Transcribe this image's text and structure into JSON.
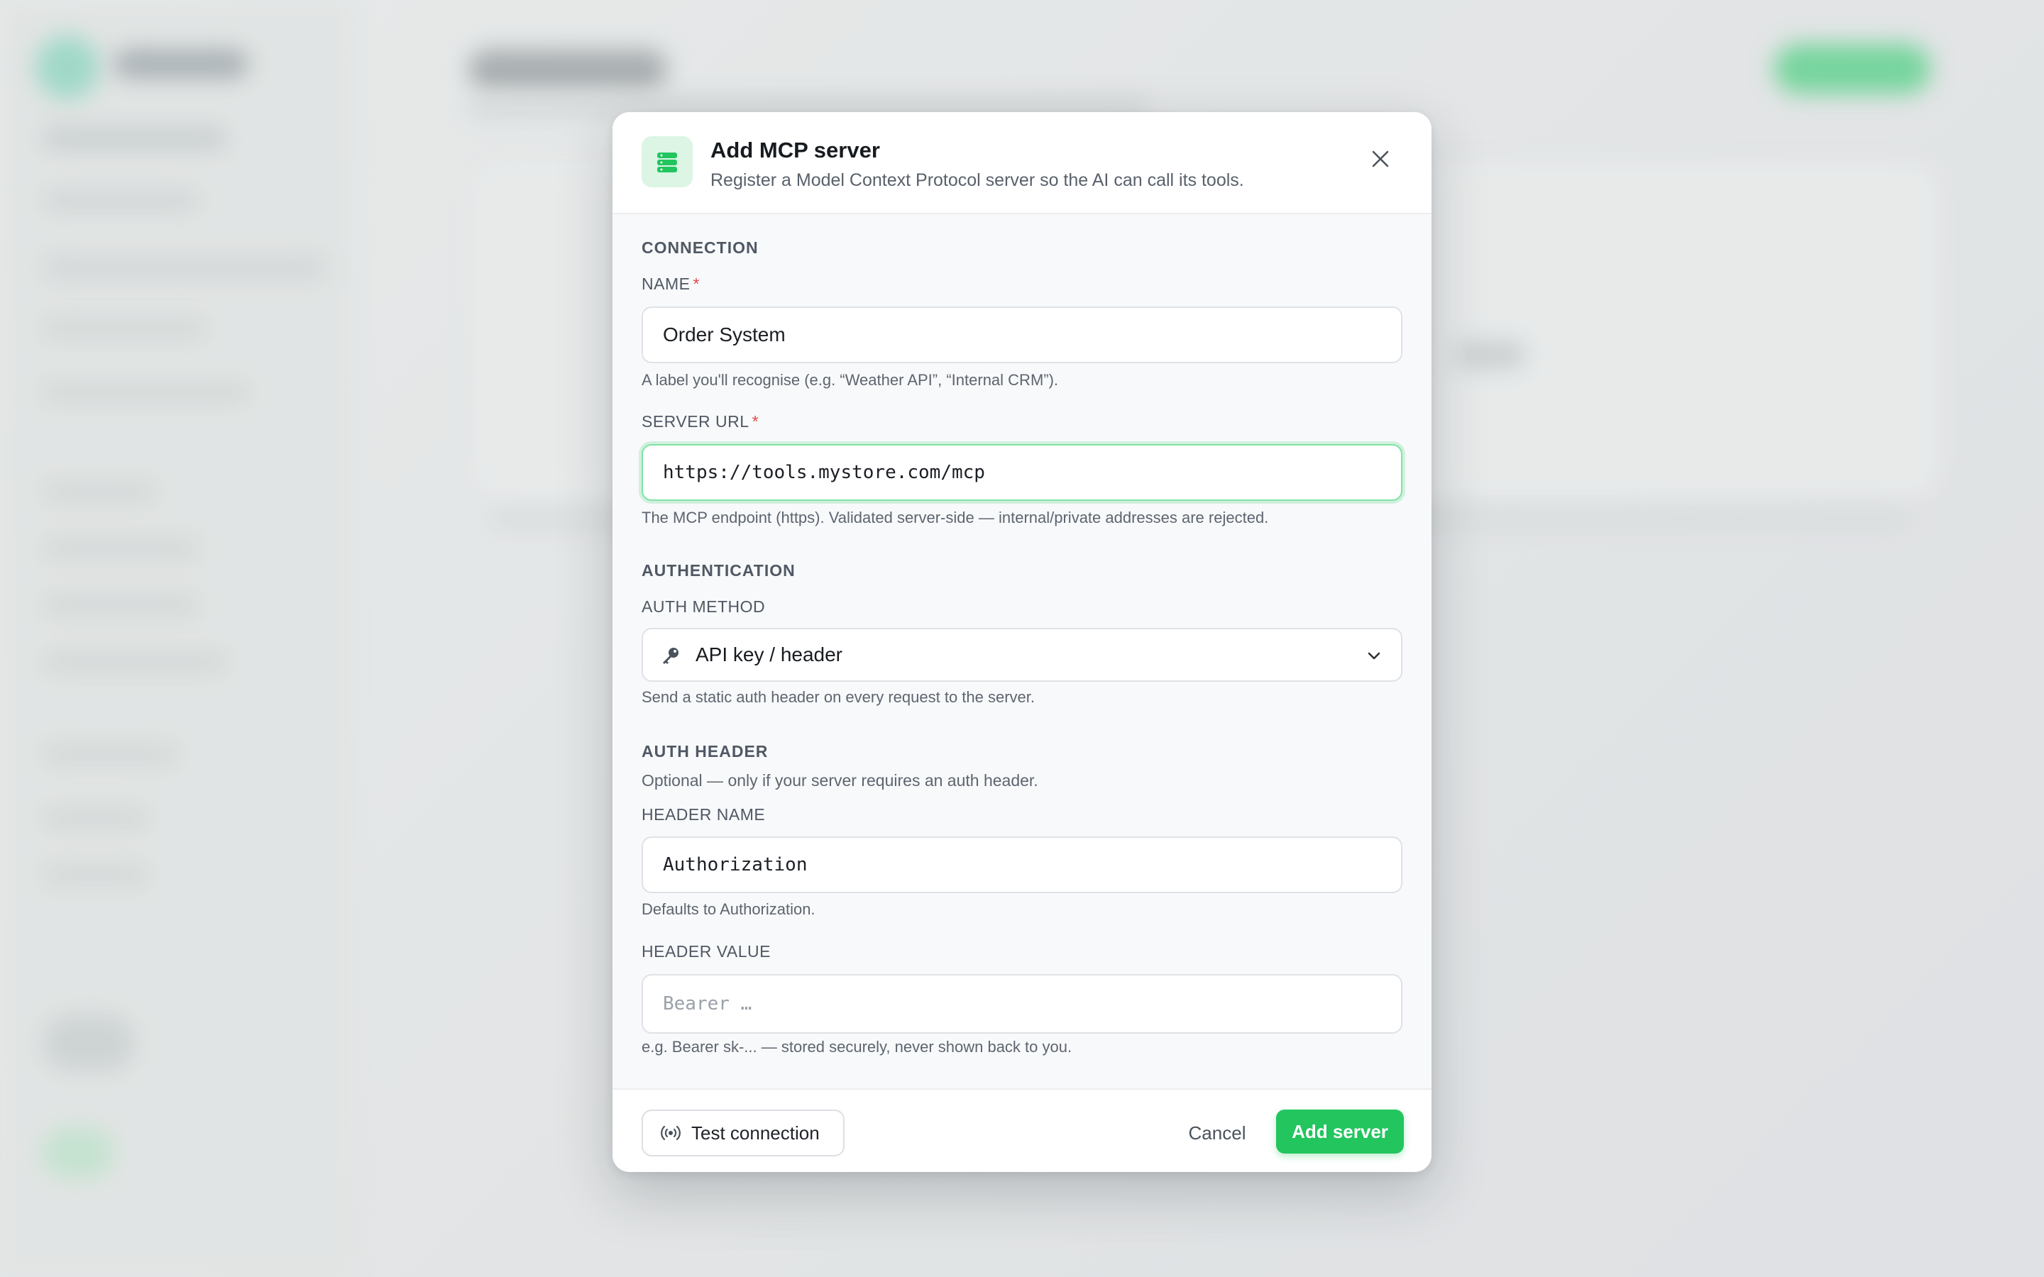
{
  "modal": {
    "title": "Add MCP server",
    "subtitle": "Register a Model Context Protocol server so the AI can call its tools.",
    "header_icon": "server-stack-icon",
    "close_icon": "close-icon"
  },
  "connection": {
    "section_title": "CONNECTION",
    "name": {
      "label": "NAME",
      "required_mark": "*",
      "value": "Order System",
      "hint": "A label you'll recognise (e.g. “Weather API”, “Internal CRM”)."
    },
    "server_url": {
      "label": "SERVER URL",
      "required_mark": "*",
      "value": "https://tools.mystore.com/mcp",
      "hint": "The MCP endpoint (https). Validated server-side — internal/private addresses are rejected."
    }
  },
  "authentication": {
    "section_title": "AUTHENTICATION",
    "auth_method": {
      "label": "AUTH METHOD",
      "selected": "API key / header",
      "icon": "key-icon",
      "hint": "Send a static auth header on every request to the server."
    }
  },
  "auth_header": {
    "section_title": "AUTH HEADER",
    "description": "Optional — only if your server requires an auth header.",
    "header_name": {
      "label": "HEADER NAME",
      "value": "Authorization",
      "hint": "Defaults to Authorization."
    },
    "header_value": {
      "label": "HEADER VALUE",
      "value": "",
      "placeholder": "Bearer …",
      "hint": "e.g. Bearer sk-... — stored securely, never shown back to you."
    }
  },
  "footer": {
    "test_label": "Test connection",
    "test_icon": "broadcast-icon",
    "cancel_label": "Cancel",
    "add_label": "Add server"
  },
  "colors": {
    "accent": "#22c55e",
    "required": "#e5484d"
  }
}
